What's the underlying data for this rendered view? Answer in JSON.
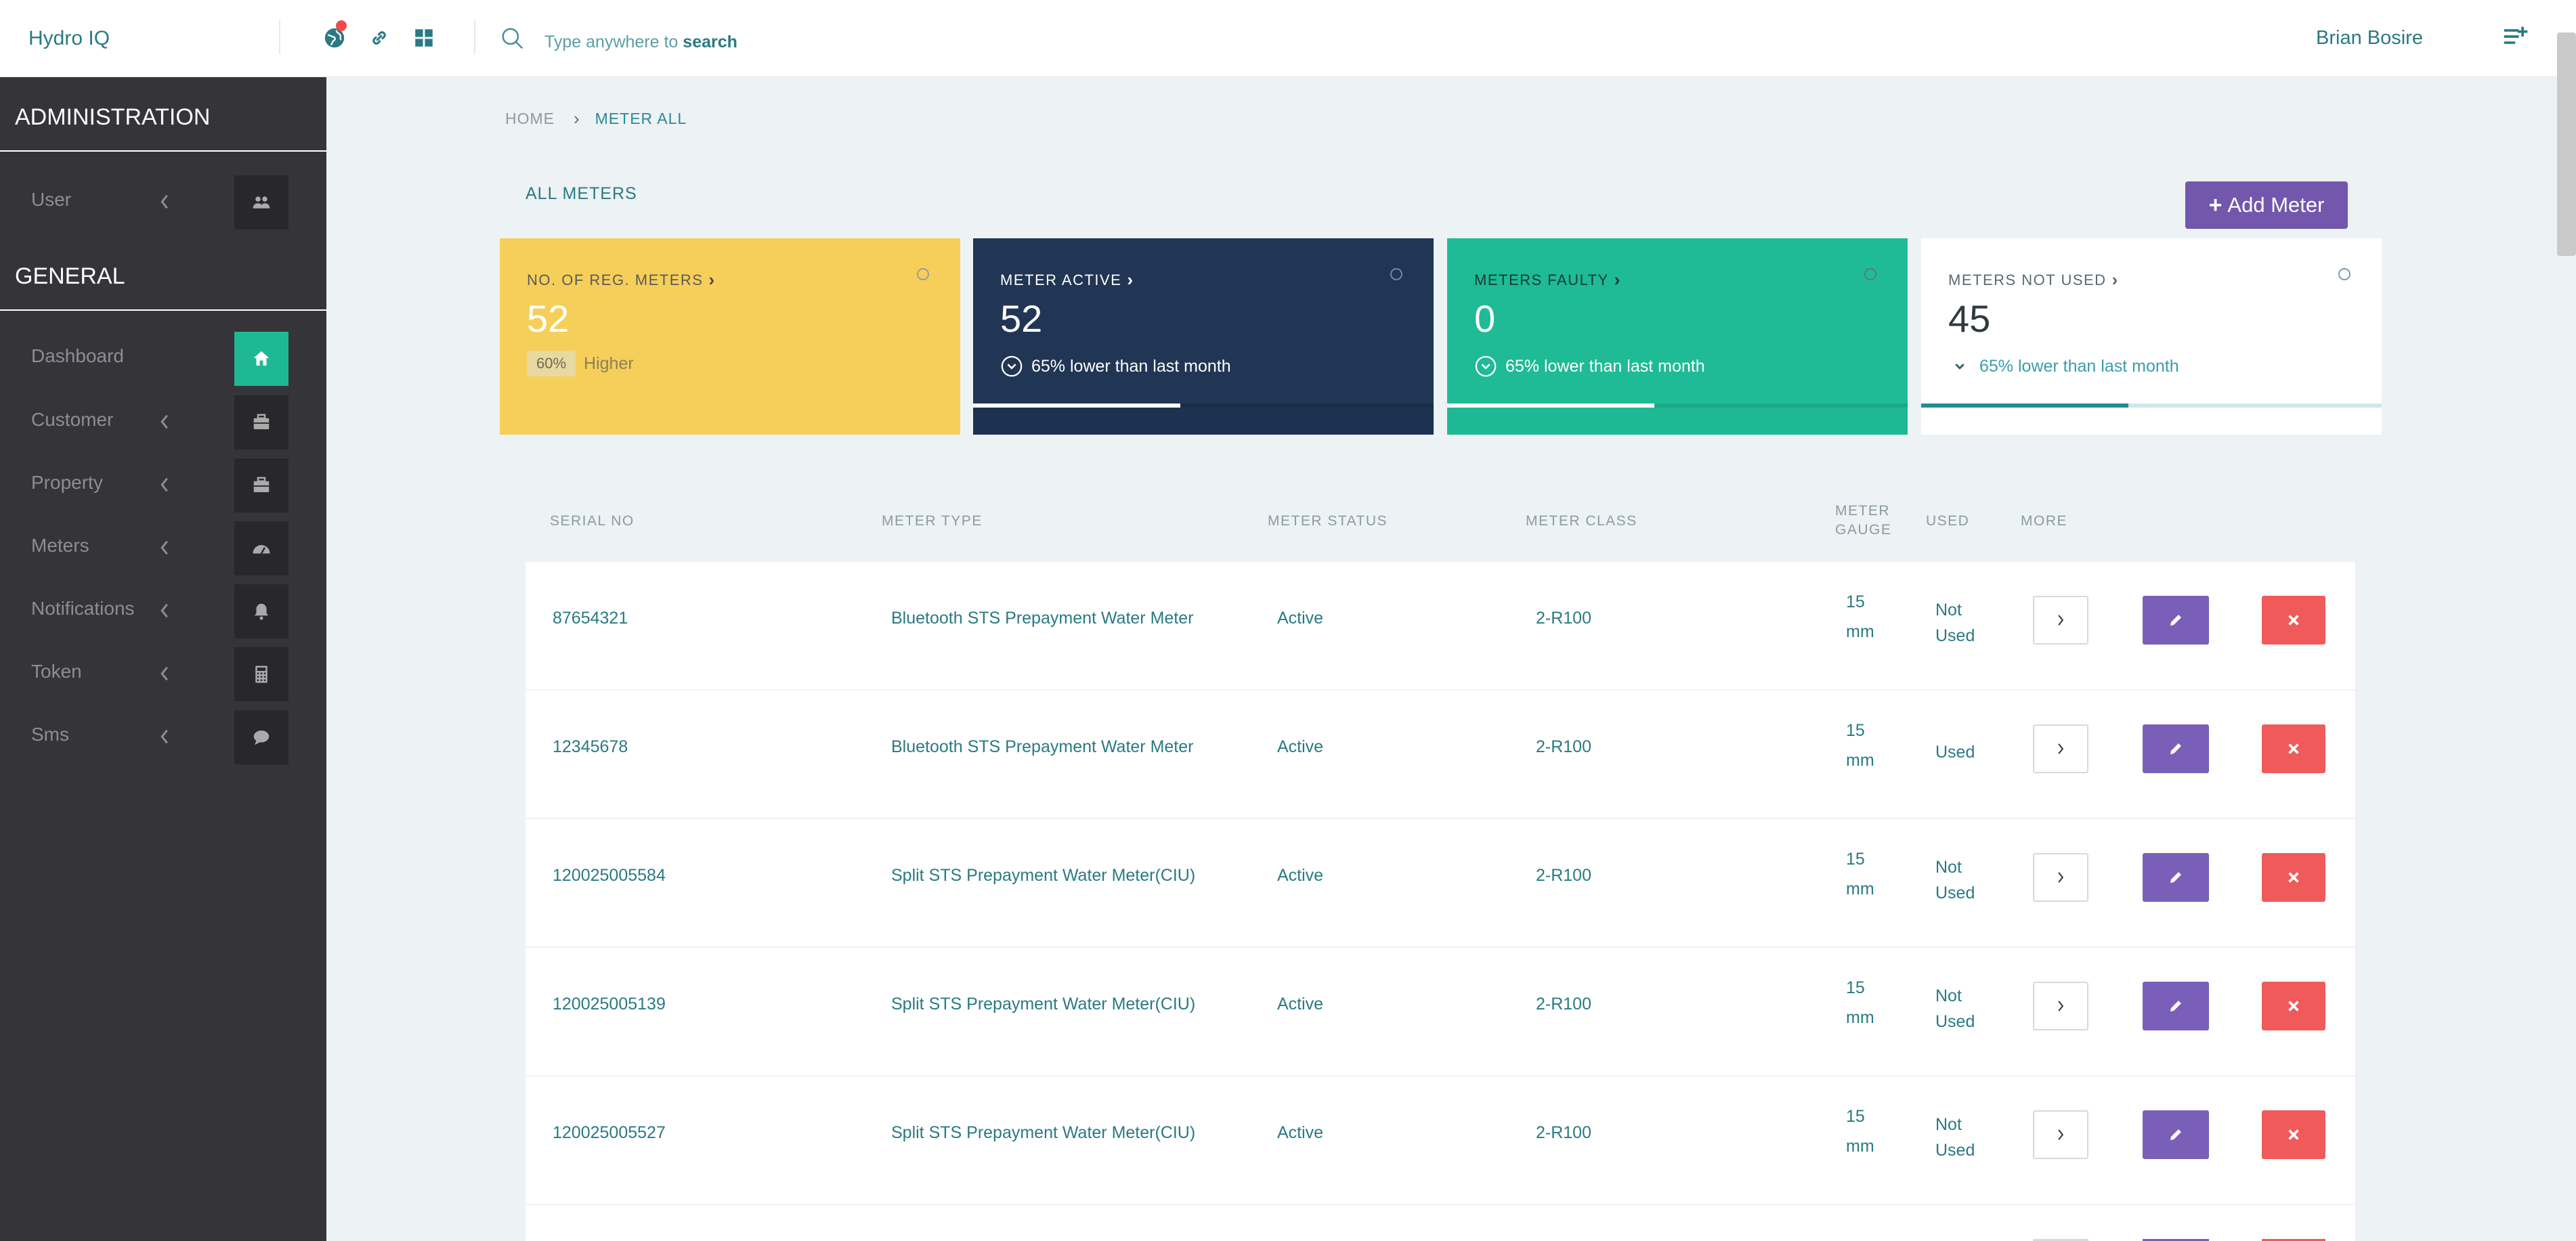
{
  "app": {
    "brand": "Hydro IQ"
  },
  "topbar": {
    "icons": [
      "globe-icon",
      "link-icon",
      "grid-icon"
    ],
    "search_prefix": "Type anywhere to ",
    "search_keyword": "search",
    "user_name": "Brian Bosire",
    "colors": {
      "notification_dot": "#f04a4a",
      "accent": "#2a7a82"
    }
  },
  "sidebar": {
    "sections": [
      {
        "title": "ADMINISTRATION",
        "items": [
          {
            "label": "User",
            "icon": "users-icon"
          }
        ]
      },
      {
        "title": "GENERAL",
        "items": [
          {
            "label": "Dashboard",
            "icon": "home-icon",
            "active": true
          },
          {
            "label": "Customer",
            "icon": "briefcase-icon"
          },
          {
            "label": "Property",
            "icon": "briefcase-icon"
          },
          {
            "label": "Meters",
            "icon": "gauge-icon"
          },
          {
            "label": "Notifications",
            "icon": "bell-icon"
          },
          {
            "label": "Token",
            "icon": "calculator-icon"
          },
          {
            "label": "Sms",
            "icon": "chat-icon"
          }
        ]
      }
    ]
  },
  "breadcrumb": {
    "home": "HOME",
    "current": "METER ALL"
  },
  "page": {
    "title": "ALL METERS",
    "add_button": "Add Meter"
  },
  "stats": [
    {
      "title": "NO. OF REG. METERS",
      "value": "52",
      "badge": "60%",
      "note": "Higher",
      "color": "#f6cf5a"
    },
    {
      "title": "METER ACTIVE",
      "value": "52",
      "note": "65% lower than last month",
      "progress": 0.45,
      "color": "#213654"
    },
    {
      "title": "METERS FAULTY",
      "value": "0",
      "note": "65% lower than last month",
      "progress": 0.45,
      "color": "#1fba96"
    },
    {
      "title": "METERS NOT USED",
      "value": "45",
      "note": "65% lower than last month",
      "progress": 0.45,
      "color": "#ffffff"
    }
  ],
  "table": {
    "headers": {
      "serial_no": "SERIAL NO",
      "meter_type": "METER TYPE",
      "meter_status": "METER STATUS",
      "meter_class": "METER CLASS",
      "meter_gauge_1": "METER",
      "meter_gauge_2": "GAUGE",
      "used": "USED",
      "more": "MORE"
    },
    "rows": [
      {
        "serial": "87654321",
        "type": "Bluetooth STS Prepayment Water Meter",
        "status": "Active",
        "class": "2-R100",
        "gauge_num": "15",
        "gauge_unit": "mm",
        "used_1": "Not",
        "used_2": "Used"
      },
      {
        "serial": "12345678",
        "type": "Bluetooth STS Prepayment Water Meter",
        "status": "Active",
        "class": "2-R100",
        "gauge_num": "15",
        "gauge_unit": "mm",
        "used_1": "Used",
        "used_2": ""
      },
      {
        "serial": "120025005584",
        "type": "Split STS Prepayment Water Meter(CIU)",
        "status": "Active",
        "class": "2-R100",
        "gauge_num": "15",
        "gauge_unit": "mm",
        "used_1": "Not",
        "used_2": "Used"
      },
      {
        "serial": "120025005139",
        "type": "Split STS Prepayment Water Meter(CIU)",
        "status": "Active",
        "class": "2-R100",
        "gauge_num": "15",
        "gauge_unit": "mm",
        "used_1": "Not",
        "used_2": "Used"
      },
      {
        "serial": "120025005527",
        "type": "Split STS Prepayment Water Meter(CIU)",
        "status": "Active",
        "class": "2-R100",
        "gauge_num": "15",
        "gauge_unit": "mm",
        "used_1": "Not",
        "used_2": "Used"
      }
    ],
    "colors": {
      "edit": "#7a5fb8",
      "delete": "#f05a5a"
    }
  }
}
